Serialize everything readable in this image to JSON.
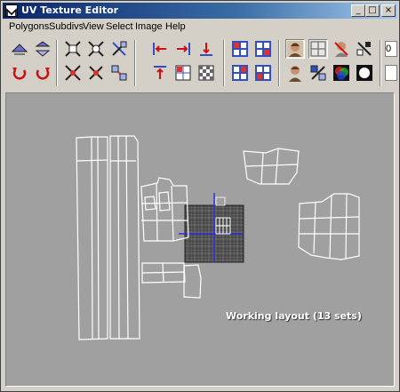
{
  "window": {
    "title": "UV Texture Editor",
    "app_icon": "maya-icon",
    "controls": {
      "minimize": "_",
      "maximize": "□",
      "close": "×"
    }
  },
  "menubar": {
    "items": [
      {
        "label": "Polygons"
      },
      {
        "label": "Subdivs"
      },
      {
        "label": "View"
      },
      {
        "label": "Select"
      },
      {
        "label": "Image"
      },
      {
        "label": "Help"
      }
    ]
  },
  "toolbar": {
    "tools": [
      {
        "name": "flip-uv-horizontal-icon"
      },
      {
        "name": "flip-uv-vertical-icon"
      },
      {
        "name": "rotate-uv-ccw-icon"
      },
      {
        "name": "rotate-uv-cw-icon"
      },
      {
        "name": "cut-uv-edges-icon"
      },
      {
        "name": "sew-uv-edges-icon"
      },
      {
        "name": "split-uvs-icon"
      },
      {
        "name": "merge-uvs-icon"
      },
      {
        "name": "move-and-sew-icon"
      },
      {
        "name": "layout-uvs-icon"
      },
      {
        "name": "align-left-icon"
      },
      {
        "name": "align-right-icon"
      },
      {
        "name": "align-top-icon"
      },
      {
        "name": "align-bottom-icon"
      },
      {
        "name": "snap-to-grid-icon"
      },
      {
        "name": "checker-icon"
      },
      {
        "name": "grid-toggle-icon"
      },
      {
        "name": "frame-selection-icon"
      },
      {
        "name": "frame-all-icon"
      },
      {
        "name": "isolate-icon"
      },
      {
        "name": "display-image-icon"
      },
      {
        "name": "grid-view-icon"
      },
      {
        "name": "show-unfiltered-icon"
      },
      {
        "name": "pixel-snap-icon"
      },
      {
        "name": "dim-image-icon"
      },
      {
        "name": "shade-uvs-icon"
      },
      {
        "name": "rgb-channels-icon"
      },
      {
        "name": "alpha-channel-icon"
      }
    ],
    "truncated_field": "0"
  },
  "viewport": {
    "caption": "Working layout (13 sets)",
    "background_color": "#a0a0a0",
    "uv_line_color": "#ffffff",
    "axis_color": "#2020d0"
  }
}
